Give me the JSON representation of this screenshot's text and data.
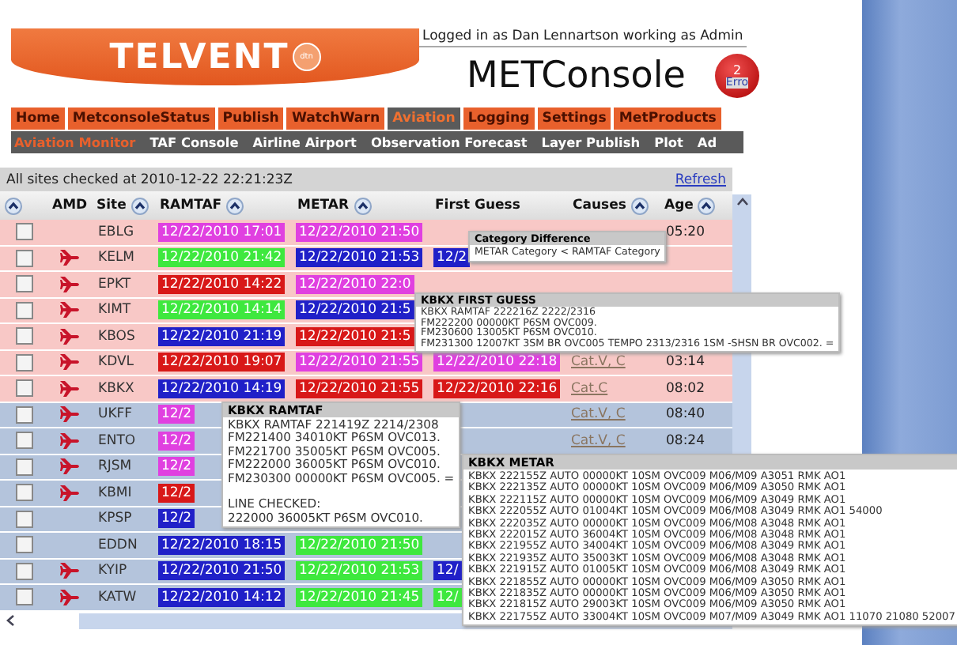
{
  "header": {
    "logo": {
      "name": "TELVENT",
      "mark": "dtn"
    },
    "login": "Logged in as Dan Lennartson working as Admin",
    "title": "METConsole",
    "badge": {
      "count": "2",
      "label": "Erro"
    }
  },
  "nav": {
    "primary": [
      {
        "label": "Home",
        "selected": false
      },
      {
        "label": "MetconsoleStatus",
        "selected": false
      },
      {
        "label": "Publish",
        "selected": false
      },
      {
        "label": "WatchWarn",
        "selected": false
      },
      {
        "label": "Aviation",
        "selected": true
      },
      {
        "label": "Logging",
        "selected": false
      },
      {
        "label": "Settings",
        "selected": false
      },
      {
        "label": "MetProducts",
        "selected": false
      }
    ],
    "secondary": [
      {
        "label": "Aviation Monitor",
        "selected": true
      },
      {
        "label": "TAF Console",
        "selected": false
      },
      {
        "label": "Airline Airport",
        "selected": false
      },
      {
        "label": "Observation Forecast",
        "selected": false
      },
      {
        "label": "Layer Publish",
        "selected": false
      },
      {
        "label": "Plot",
        "selected": false
      },
      {
        "label": "Ad",
        "selected": false
      }
    ]
  },
  "status": {
    "text": "All sites checked at 2010-12-22 22:21:23Z",
    "refresh": "Refresh"
  },
  "columns": [
    {
      "sortable": true
    },
    {
      "label": "AMD",
      "sortable": false
    },
    {
      "label": "Site",
      "sortable": true
    },
    {
      "label": "RAMTAF",
      "sortable": true
    },
    {
      "label": "METAR",
      "sortable": true
    },
    {
      "label": "First Guess",
      "sortable": false
    },
    {
      "label": "Causes",
      "sortable": true
    },
    {
      "label": "Age",
      "sortable": true
    }
  ],
  "rows": [
    {
      "checked": false,
      "alert": true,
      "amd": false,
      "site": "EBLG",
      "ramtaf": {
        "time": "12/22/2010 17:01",
        "color": "#e040e0"
      },
      "metar": {
        "time": "12/22/2010 21:50",
        "color": "#e040e0"
      },
      "age": "05:20"
    },
    {
      "checked": false,
      "alert": true,
      "amd": true,
      "site": "KELM",
      "ramtaf": {
        "time": "12/22/2010 21:42",
        "color": "#3ee83e"
      },
      "metar": {
        "time": "12/22/2010 21:53",
        "color": "#2020c8"
      },
      "first_guess": {
        "time": "12/2",
        "color": "#2020c8"
      }
    },
    {
      "checked": false,
      "alert": true,
      "amd": true,
      "site": "EPKT",
      "ramtaf": {
        "time": "12/22/2010 14:22",
        "color": "#d81818"
      },
      "metar": {
        "time": "12/22/2010 22:0",
        "color": "#e040e0"
      }
    },
    {
      "checked": false,
      "alert": true,
      "amd": true,
      "site": "KIMT",
      "ramtaf": {
        "time": "12/22/2010 14:14",
        "color": "#3ee83e"
      },
      "metar": {
        "time": "12/22/2010 21:5",
        "color": "#2020c8"
      }
    },
    {
      "checked": false,
      "alert": true,
      "amd": true,
      "site": "KBOS",
      "ramtaf": {
        "time": "12/22/2010 21:19",
        "color": "#2020c8"
      },
      "metar": {
        "time": "12/22/2010 21:5",
        "color": "#d81818"
      }
    },
    {
      "checked": false,
      "alert": true,
      "amd": true,
      "site": "KDVL",
      "ramtaf": {
        "time": "12/22/2010 19:07",
        "color": "#d81818"
      },
      "metar": {
        "time": "12/22/2010 21:55",
        "color": "#e040e0"
      },
      "first_guess": {
        "time": "12/22/2010 22:18",
        "color": "#e040e0"
      },
      "causes": "Cat.V, C",
      "age": "03:14"
    },
    {
      "checked": false,
      "alert": true,
      "amd": true,
      "site": "KBKX",
      "ramtaf": {
        "time": "12/22/2010 14:19",
        "color": "#2020c8"
      },
      "metar": {
        "time": "12/22/2010 21:55",
        "color": "#d81818"
      },
      "first_guess": {
        "time": "12/22/2010 22:16",
        "color": "#d81818"
      },
      "causes": "Cat.C",
      "age": "08:02"
    },
    {
      "checked": false,
      "alert": false,
      "amd": true,
      "site": "UKFF",
      "ramtaf": {
        "time": "12/2",
        "color": "#e040e0"
      },
      "causes": "Cat.V, C",
      "age": "08:40"
    },
    {
      "checked": false,
      "alert": false,
      "amd": true,
      "site": "ENTO",
      "ramtaf": {
        "time": "12/2",
        "color": "#e040e0"
      },
      "causes": "Cat.V, C",
      "age": "08:24"
    },
    {
      "checked": false,
      "alert": false,
      "amd": true,
      "site": "RJSM",
      "ramtaf": {
        "time": "12/2",
        "color": "#e040e0"
      }
    },
    {
      "checked": false,
      "alert": false,
      "amd": true,
      "site": "KBMI",
      "ramtaf": {
        "time": "12/2",
        "color": "#d81818"
      }
    },
    {
      "checked": false,
      "alert": false,
      "amd": false,
      "site": "KPSP",
      "ramtaf": {
        "time": "12/2",
        "color": "#2020c8"
      }
    },
    {
      "checked": false,
      "alert": false,
      "amd": false,
      "site": "EDDN",
      "ramtaf": {
        "time": "12/22/2010 18:15",
        "color": "#2020c8"
      },
      "metar": {
        "time": "12/22/2010 21:50",
        "color": "#3ee83e"
      }
    },
    {
      "checked": false,
      "alert": false,
      "amd": true,
      "site": "KYIP",
      "ramtaf": {
        "time": "12/22/2010 21:50",
        "color": "#2020c8"
      },
      "metar": {
        "time": "12/22/2010 21:53",
        "color": "#3ee83e"
      },
      "first_guess": {
        "time": "12/",
        "color": "#2020c8"
      }
    },
    {
      "checked": false,
      "alert": false,
      "amd": true,
      "site": "KATW",
      "ramtaf": {
        "time": "12/22/2010 14:12",
        "color": "#2020c8"
      },
      "metar": {
        "time": "12/22/2010 21:45",
        "color": "#3ee83e"
      },
      "first_guess": {
        "time": "12/",
        "color": "#3ee83e"
      }
    }
  ],
  "popups": [
    {
      "title": "Category Difference",
      "lines": [
        "METAR Category < RAMTAF Category"
      ]
    },
    {
      "title": "KBKX FIRST GUESS",
      "lines": [
        "KBKX RAMTAF 222216Z 2222/2316",
        "FM222200 00000KT P6SM OVC009.",
        "FM230600 13005KT P6SM OVC010.",
        "FM231300 12007KT 3SM BR OVC005 TEMPO 2313/2316 1SM -SHSN BR OVC002. ="
      ]
    },
    {
      "title": "KBKX RAMTAF",
      "lines": [
        "KBKX RAMTAF 221419Z 2214/2308",
        "FM221400 34010KT P6SM OVC013.",
        "FM221700 35005KT P6SM OVC005.",
        "FM222000 36005KT P6SM OVC010.",
        "FM230300 00000KT P6SM OVC005. ="
      ],
      "checked_label": "LINE CHECKED:",
      "checked_line": "222000 36005KT P6SM OVC010."
    },
    {
      "title": "KBKX METAR",
      "lines": [
        "KBKX 222155Z AUTO 00000KT 10SM OVC009 M06/M09 A3051 RMK AO1",
        "KBKX 222135Z AUTO 00000KT 10SM OVC009 M06/M09 A3050 RMK AO1",
        "KBKX 222115Z AUTO 00000KT 10SM OVC009 M06/M09 A3049 RMK AO1",
        "KBKX 222055Z AUTO 01004KT 10SM OVC009 M06/M08 A3049 RMK AO1 54000",
        "KBKX 222035Z AUTO 00000KT 10SM OVC009 M06/M08 A3048 RMK AO1",
        "KBKX 222015Z AUTO 36004KT 10SM OVC009 M06/M08 A3048 RMK AO1",
        "KBKX 221955Z AUTO 34004KT 10SM OVC009 M06/M08 A3049 RMK AO1",
        "KBKX 221935Z AUTO 35003KT 10SM OVC009 M06/M08 A3048 RMK AO1",
        "KBKX 221915Z AUTO 01005KT 10SM OVC009 M06/M08 A3049 RMK AO1",
        "KBKX 221855Z AUTO 00000KT 10SM OVC009 M06/M09 A3050 RMK AO1",
        "KBKX 221835Z AUTO 00000KT 10SM OVC009 M06/M09 A3050 RMK AO1",
        "KBKX 221815Z AUTO 29003KT 10SM OVC009 M06/M09 A3050 RMK AO1",
        "KBKX 221755Z AUTO 33004KT 10SM OVC009 M07/M09 A3049 RMK AO1 11070 21080 52007"
      ]
    }
  ]
}
